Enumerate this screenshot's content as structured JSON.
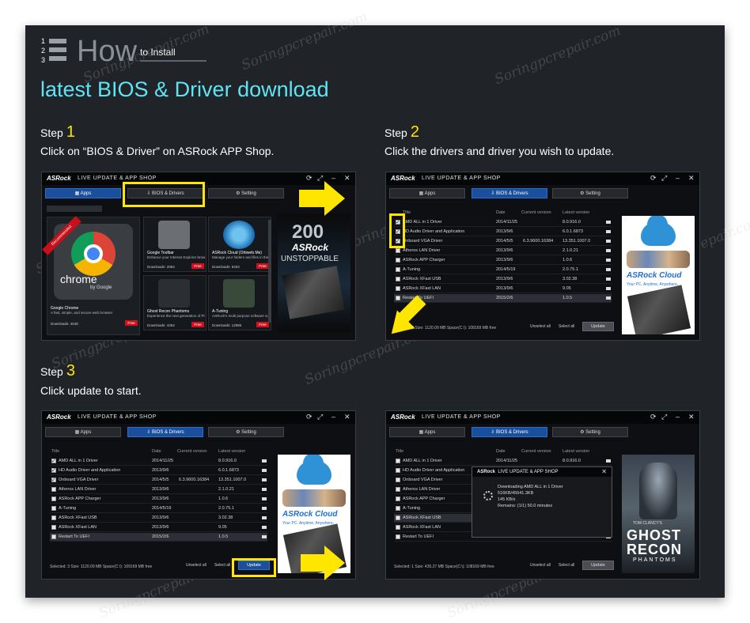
{
  "watermark": "Soringpcrepair.com",
  "header": {
    "icon_numbers": [
      "1",
      "2",
      "3"
    ],
    "how": "How",
    "to_install": "to Install",
    "title": "latest BIOS & Driver download"
  },
  "steps": [
    {
      "label": "Step",
      "num": "1",
      "desc": "Click on “BIOS & Driver” on ASRock APP Shop."
    },
    {
      "label": "Step",
      "num": "2",
      "desc": "Click the drivers and driver you wish to update."
    },
    {
      "label": "Step",
      "num": "3",
      "desc": "Click update to start."
    }
  ],
  "app_window": {
    "logo": "ASRock",
    "title": "LIVE UPDATE & APP SHOP",
    "tabs": {
      "apps": "Apps",
      "bios": "BIOS & Drivers",
      "setting": "Setting"
    },
    "columns": {
      "title": "Title",
      "date": "Date",
      "current": "Current version",
      "latest": "Latest version"
    },
    "drivers": [
      {
        "name": "AMD ALL in 1 Driver",
        "date": "2014/11/25",
        "current": "",
        "latest": "8.0.916.0"
      },
      {
        "name": "HD Audio Driver and Application",
        "date": "2013/9/6",
        "current": "",
        "latest": "6.0.1.6873"
      },
      {
        "name": "Onboard VGA Driver",
        "date": "2014/5/5",
        "current": "6.3.9600.16384",
        "latest": "13.351.1007.0"
      },
      {
        "name": "Atheros LAN Driver",
        "date": "2013/9/6",
        "current": "",
        "latest": "2.1.0.21"
      },
      {
        "name": "ASRock APP Charger",
        "date": "2013/9/6",
        "current": "",
        "latest": "1.0.6"
      },
      {
        "name": "A-Tuning",
        "date": "2014/5/19",
        "current": "",
        "latest": "2.0.75.1"
      },
      {
        "name": "ASRock XFast USB",
        "date": "2013/9/6",
        "current": "",
        "latest": "3.02.38"
      },
      {
        "name": "ASRock XFast LAN",
        "date": "2013/9/6",
        "current": "",
        "latest": "9.05"
      },
      {
        "name": "Restart To UEFI",
        "date": "2015/2/6",
        "current": "",
        "latest": "1.0.5"
      }
    ],
    "footer_step2": "Selected: 3  Size: 1120.09 MB  Space(C:\\): 108169 MB free",
    "footer_step3": "Selected: 3  Size: 1120.09 MB  Space(C:\\): 109169 MB free",
    "footer_step3b": "Selected: 1  Size: 435.27 MB  Space(C:\\): 108169 MB free",
    "unselect_all": "Unselect all",
    "select_all": "Select all",
    "update": "Update"
  },
  "apps_shop": {
    "chrome_badge": "Recommended",
    "chrome_name": "Google Chrome",
    "chrome_desc": "A fast, simple, and secure web browser",
    "chrome_dl": "Downloads: 4648",
    "chrome_word": "chrome",
    "chrome_by": "by Google",
    "apps": [
      {
        "name": "Google Toolbar",
        "desc": "Enhance your Internet Explorer brow",
        "dl": "Downloads: 2953",
        "free": "Free"
      },
      {
        "name": "ASRock Cloud (Orbweb.Me)",
        "desc": "Manage your folders and files in the",
        "dl": "Downloads: 6463",
        "free": "Free"
      },
      {
        "name": "Ghost Recon Phantoms",
        "desc": "Experience the next generation of Pl",
        "dl": "Downloads: 4354",
        "free": "Free"
      },
      {
        "name": "A-Tuning",
        "desc": "ASRock's multi purpose software suit",
        "dl": "Downloads: 12986",
        "free": "Free"
      }
    ],
    "ad_big": "200",
    "ad_asrock": "ASRock",
    "ad_unstoppable": "UNSTOPPABLE"
  },
  "cloud_ad": {
    "brand": "ASRock Cloud",
    "tagline": "Your PC. Anytime, Anywhere."
  },
  "download_popup": {
    "title": "LIVE UPDATE & APP SHOP",
    "line1": "Downloading AMD ALL in 1 Driver",
    "line2": "516KB/45641.3KB",
    "line3": "145 KB/s",
    "line4": "Remains: (1/1) 50.0 minutes"
  },
  "ghost_ad": {
    "top": "TOM CLANCY'S",
    "line1": "GHOST",
    "line2": "RECON",
    "line3": "PHANTOMS"
  },
  "colors": {
    "accent": "#5fe4f4",
    "highlight": "#ffe600",
    "panel": "#202328",
    "tab_active": "#1a4f9c"
  }
}
